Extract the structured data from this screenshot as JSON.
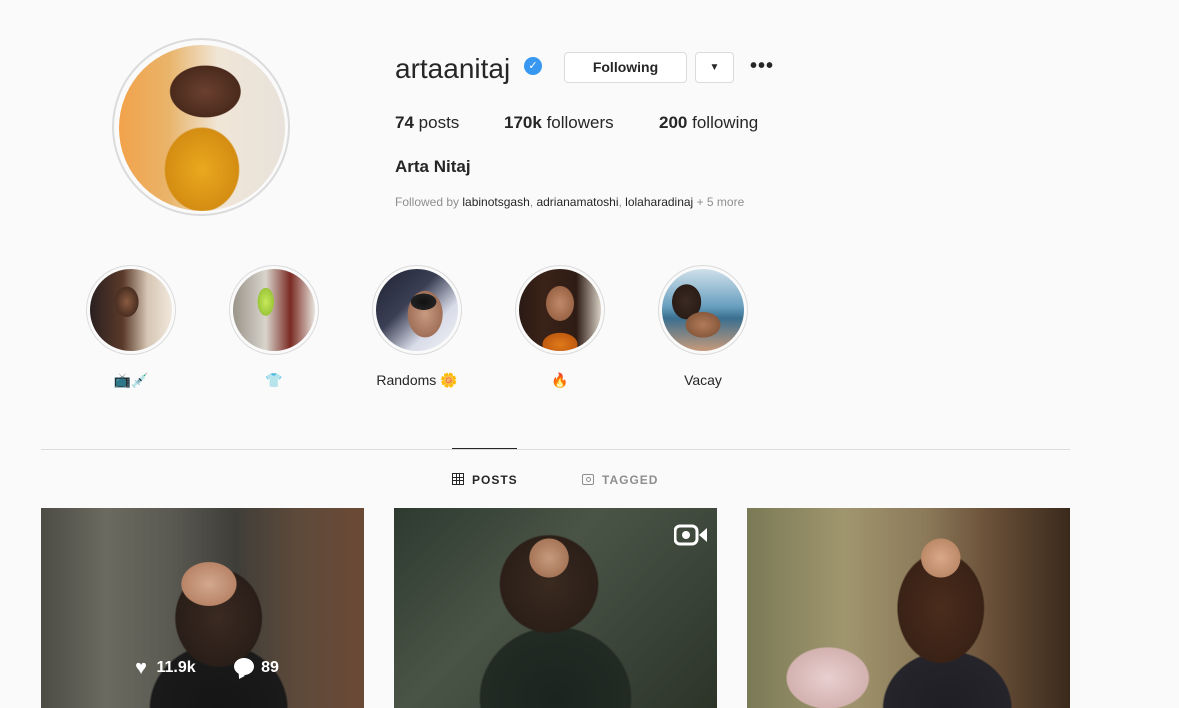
{
  "profile": {
    "username": "artaanitaj",
    "verified_icon": "verified-badge-icon",
    "following_label": "Following",
    "dropdown_icon": "▼",
    "more_icon": "•••",
    "posts_count": "74",
    "posts_label": "posts",
    "followers_count": "170k",
    "followers_label": "followers",
    "following_count": "200",
    "following_stat_label": "following",
    "full_name": "Arta Nitaj",
    "followed_by_prefix": "Followed by",
    "followed_by_users": [
      "labinotsgash",
      "adrianamatoshi",
      "lolaharadinaj"
    ],
    "followed_by_more": "+ 5 more"
  },
  "highlights": [
    {
      "label": "📺💉"
    },
    {
      "label": "👕"
    },
    {
      "label": "Randoms 🌼"
    },
    {
      "label": "🔥"
    },
    {
      "label": "Vacay"
    }
  ],
  "tabs": {
    "posts": "POSTS",
    "tagged": "TAGGED"
  },
  "posts": [
    {
      "likes": "11.9k",
      "comments": "89"
    }
  ],
  "colors": {
    "verified": "#3897f0",
    "background": "#fafafa",
    "border": "#dbdbdb"
  }
}
